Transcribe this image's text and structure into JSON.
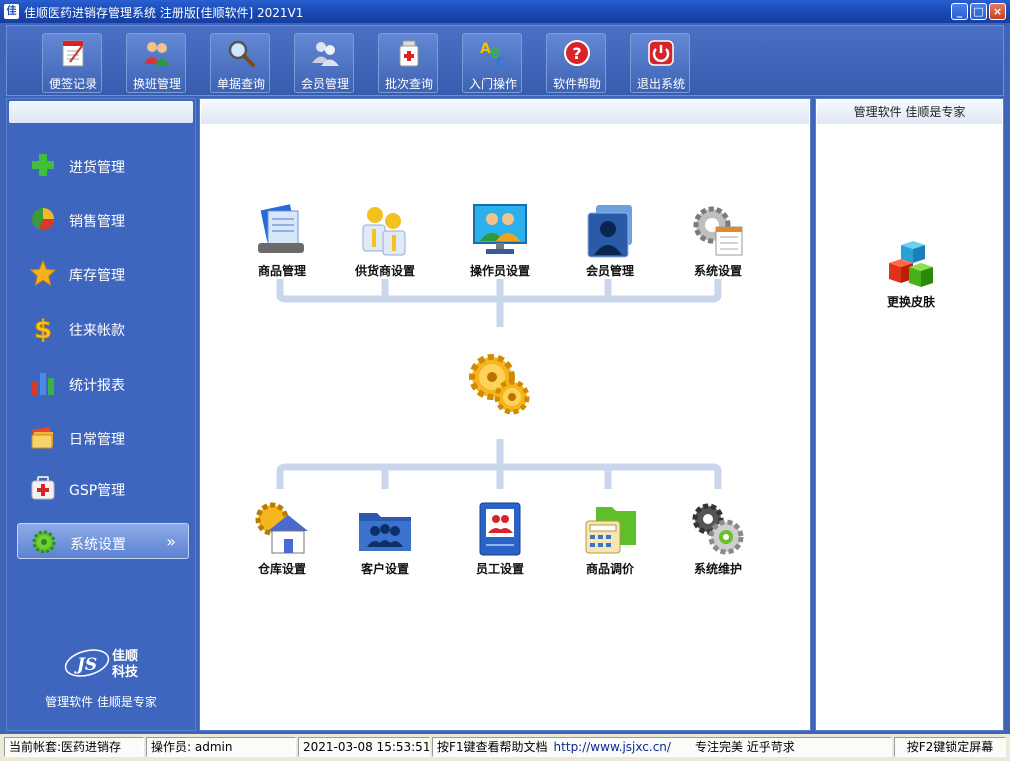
{
  "window": {
    "title": "佳顺医药进销存管理系统 注册版[佳顺软件] 2021V1",
    "controls": [
      "_",
      "□",
      "×"
    ]
  },
  "toolbar": {
    "items": [
      {
        "label": "便签记录",
        "icon": "notepad-icon"
      },
      {
        "label": "换班管理",
        "icon": "users-shift-icon"
      },
      {
        "label": "单据查询",
        "icon": "magnifier-icon"
      },
      {
        "label": "会员管理",
        "icon": "members-icon"
      },
      {
        "label": "批次查询",
        "icon": "medicine-bottle-icon"
      },
      {
        "label": "入门操作",
        "icon": "abc-blocks-icon"
      },
      {
        "label": "软件帮助",
        "icon": "help-icon"
      },
      {
        "label": "退出系统",
        "icon": "power-icon"
      }
    ]
  },
  "sidebar": {
    "items": [
      {
        "label": "进货管理",
        "icon": "plus-icon"
      },
      {
        "label": "销售管理",
        "icon": "pie-chart-icon"
      },
      {
        "label": "库存管理",
        "icon": "star-icon"
      },
      {
        "label": "往来帐款",
        "icon": "dollar-icon"
      },
      {
        "label": "统计报表",
        "icon": "bar-chart-icon"
      },
      {
        "label": "日常管理",
        "icon": "folders-icon"
      },
      {
        "label": "GSP管理",
        "icon": "first-aid-icon"
      },
      {
        "label": "系统设置",
        "icon": "gear-icon",
        "active": true,
        "chevron": "»"
      }
    ],
    "brand": {
      "logo_text": "JS",
      "name_line1": "佳顺",
      "name_line2": "科技",
      "slogan": "管理软件 佳顺是专家"
    }
  },
  "main": {
    "top_items": [
      {
        "label": "商品管理",
        "icon": "product-docs-icon"
      },
      {
        "label": "供货商设置",
        "icon": "suppliers-icon"
      },
      {
        "label": "操作员设置",
        "icon": "operators-monitor-icon"
      },
      {
        "label": "会员管理",
        "icon": "member-cards-icon"
      },
      {
        "label": "系统设置",
        "icon": "system-settings-icon"
      }
    ],
    "bottom_items": [
      {
        "label": "仓库设置",
        "icon": "warehouse-icon"
      },
      {
        "label": "客户设置",
        "icon": "customers-folder-icon"
      },
      {
        "label": "员工设置",
        "icon": "staff-book-icon"
      },
      {
        "label": "商品调价",
        "icon": "calculator-icon"
      },
      {
        "label": "系统维护",
        "icon": "maintenance-gears-icon"
      }
    ]
  },
  "right_panel": {
    "header": "管理软件 佳顺是专家",
    "skin_label": "更换皮肤"
  },
  "statusbar": {
    "account": "当前帐套:医药进销存",
    "operator": "操作员: admin",
    "datetime": "2021-03-08 15:53:51",
    "help_text": "按F1键查看帮助文档",
    "url": "http://www.jsjxc.cn/",
    "motto": "专注完美 近乎苛求",
    "lock_hint": "按F2键锁定屏幕"
  },
  "colors": {
    "frame": "#3f65bb",
    "title_bar": "#1848b4",
    "panel_white": "#ffffff",
    "connector_lines": "#c9d6ec"
  }
}
